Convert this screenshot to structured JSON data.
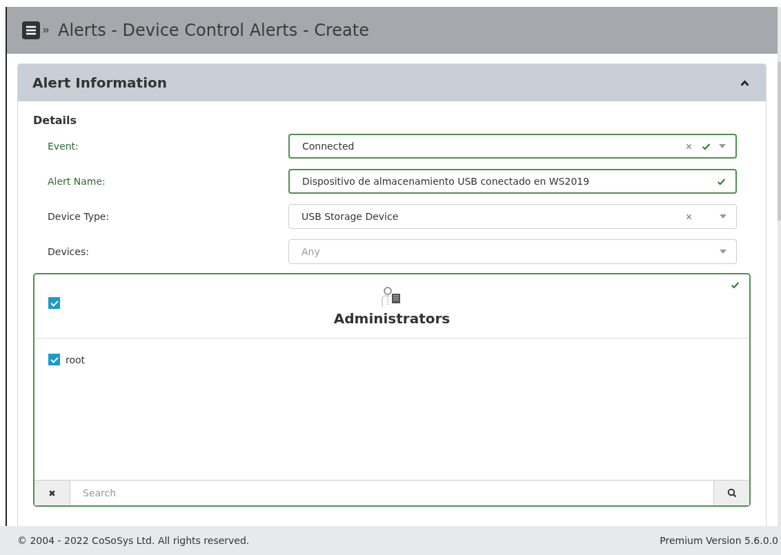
{
  "header": {
    "title": "Alerts - Device Control Alerts - Create"
  },
  "panel": {
    "title": "Alert Information",
    "expanded": true,
    "section": "Details",
    "fields": [
      {
        "label": "Event:",
        "kind": "select",
        "value": "Connected",
        "clearable": true,
        "valid": true
      },
      {
        "label": "Alert Name:",
        "kind": "text",
        "value": "Dispositivo de almacenamiento USB conectado en WS2019",
        "clearable": false,
        "valid": true
      },
      {
        "label": "Device Type:",
        "kind": "select",
        "value": "USB Storage Device",
        "clearable": true,
        "valid": false
      },
      {
        "label": "Devices:",
        "kind": "select",
        "placeholder": "Any",
        "clearable": false,
        "valid": false
      }
    ],
    "group": {
      "title": "Administrators",
      "checked": true,
      "valid": true,
      "users": [
        {
          "name": "root",
          "checked": true
        }
      ],
      "search": {
        "placeholder": "Search"
      }
    }
  },
  "footer": {
    "copyright": "© 2004 - 2022 CoSoSys Ltd. All rights reserved.",
    "version": "Premium Version 5.6.0.0"
  }
}
